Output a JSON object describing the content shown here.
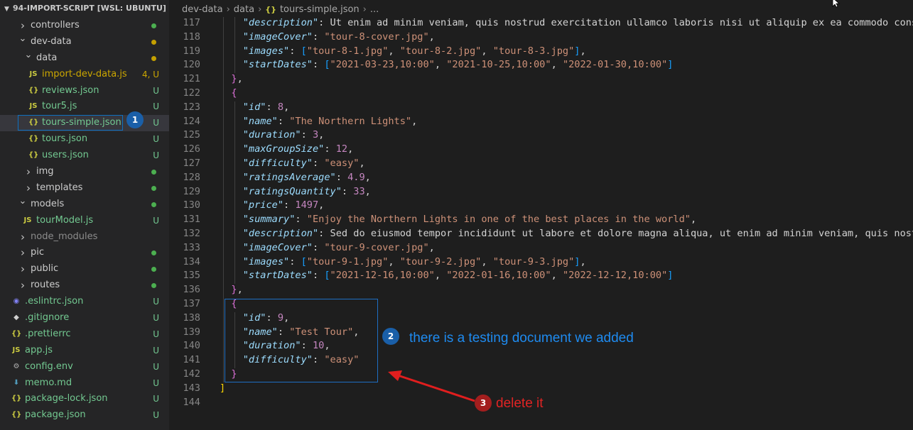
{
  "explorer": {
    "title": "94-IMPORT-SCRIPT [WSL: UBUNTU]",
    "items": [
      {
        "label": "controllers",
        "type": "folder",
        "depth": 1,
        "open": false,
        "status": "",
        "dot": "#4caf50",
        "color": "#cccccc"
      },
      {
        "label": "dev-data",
        "type": "folder",
        "depth": 1,
        "open": true,
        "status": "",
        "dot": "#c4a000",
        "color": "#cccccc"
      },
      {
        "label": "data",
        "type": "folder",
        "depth": 2,
        "open": true,
        "status": "",
        "dot": "#c4a000",
        "color": "#cccccc"
      },
      {
        "label": "import-dev-data.js",
        "type": "js",
        "depth": 3,
        "status": "4, U",
        "color": "#cca700"
      },
      {
        "label": "reviews.json",
        "type": "json",
        "depth": 3,
        "status": "U",
        "color": "#73c991"
      },
      {
        "label": "tour5.js",
        "type": "js",
        "depth": 3,
        "status": "U",
        "color": "#73c991"
      },
      {
        "label": "tours-simple.json",
        "type": "json",
        "depth": 3,
        "status": "U",
        "color": "#73c991",
        "selected": true
      },
      {
        "label": "tours.json",
        "type": "json",
        "depth": 3,
        "status": "U",
        "color": "#73c991"
      },
      {
        "label": "users.json",
        "type": "json",
        "depth": 3,
        "status": "U",
        "color": "#73c991"
      },
      {
        "label": "img",
        "type": "folder",
        "depth": 2,
        "open": false,
        "status": "",
        "dot": "#4caf50",
        "color": "#cccccc"
      },
      {
        "label": "templates",
        "type": "folder",
        "depth": 2,
        "open": false,
        "status": "",
        "dot": "#4caf50",
        "color": "#cccccc"
      },
      {
        "label": "models",
        "type": "folder",
        "depth": 1,
        "open": true,
        "status": "",
        "dot": "#4caf50",
        "color": "#cccccc"
      },
      {
        "label": "tourModel.js",
        "type": "js",
        "depth": 2,
        "status": "U",
        "color": "#73c991"
      },
      {
        "label": "node_modules",
        "type": "folder",
        "depth": 1,
        "open": false,
        "status": "",
        "dot": "",
        "color": "#8c8c8c"
      },
      {
        "label": "pic",
        "type": "folder",
        "depth": 1,
        "open": false,
        "status": "",
        "dot": "#4caf50",
        "color": "#cccccc"
      },
      {
        "label": "public",
        "type": "folder",
        "depth": 1,
        "open": false,
        "status": "",
        "dot": "#4caf50",
        "color": "#cccccc"
      },
      {
        "label": "routes",
        "type": "folder",
        "depth": 1,
        "open": false,
        "status": "",
        "dot": "#4caf50",
        "color": "#cccccc"
      },
      {
        "label": ".eslintrc.json",
        "type": "eslint",
        "depth": 0,
        "status": "U",
        "color": "#73c991"
      },
      {
        "label": ".gitignore",
        "type": "git",
        "depth": 0,
        "status": "U",
        "color": "#73c991"
      },
      {
        "label": ".prettierrc",
        "type": "json",
        "depth": 0,
        "status": "U",
        "color": "#73c991"
      },
      {
        "label": "app.js",
        "type": "js",
        "depth": 0,
        "status": "U",
        "color": "#73c991"
      },
      {
        "label": "config.env",
        "type": "gear",
        "depth": 0,
        "status": "U",
        "color": "#73c991"
      },
      {
        "label": "memo.md",
        "type": "md",
        "depth": 0,
        "status": "U",
        "color": "#73c991"
      },
      {
        "label": "package-lock.json",
        "type": "json",
        "depth": 0,
        "status": "U",
        "color": "#73c991"
      },
      {
        "label": "package.json",
        "type": "json",
        "depth": 0,
        "status": "U",
        "color": "#73c991"
      }
    ]
  },
  "breadcrumb": {
    "parts": [
      "dev-data",
      "data"
    ],
    "file": "tours-simple.json",
    "trailing": "..."
  },
  "code_lines": [
    {
      "n": "117",
      "t": "    \"description\": \"Ut enim ad minim veniam, quis nostrud exercitation ullamco laboris nisi ut aliquip ex ea commodo conse"
    },
    {
      "n": "118",
      "t": "    \"imageCover\": \"tour-8-cover.jpg\","
    },
    {
      "n": "119",
      "t": "    \"images\": [\"tour-8-1.jpg\", \"tour-8-2.jpg\", \"tour-8-3.jpg\"],"
    },
    {
      "n": "120",
      "t": "    \"startDates\": [\"2021-03-23,10:00\", \"2021-10-25,10:00\", \"2022-01-30,10:00\"]"
    },
    {
      "n": "121",
      "t": "  },"
    },
    {
      "n": "122",
      "t": "  {"
    },
    {
      "n": "123",
      "t": "    \"id\": 8,"
    },
    {
      "n": "124",
      "t": "    \"name\": \"The Northern Lights\","
    },
    {
      "n": "125",
      "t": "    \"duration\": 3,"
    },
    {
      "n": "126",
      "t": "    \"maxGroupSize\": 12,"
    },
    {
      "n": "127",
      "t": "    \"difficulty\": \"easy\","
    },
    {
      "n": "128",
      "t": "    \"ratingsAverage\": 4.9,"
    },
    {
      "n": "129",
      "t": "    \"ratingsQuantity\": 33,"
    },
    {
      "n": "130",
      "t": "    \"price\": 1497,"
    },
    {
      "n": "131",
      "t": "    \"summary\": \"Enjoy the Northern Lights in one of the best places in the world\","
    },
    {
      "n": "132",
      "t": "    \"description\": \"Sed do eiusmod tempor incididunt ut labore et dolore magna aliqua, ut enim ad minim veniam, quis nostr"
    },
    {
      "n": "133",
      "t": "    \"imageCover\": \"tour-9-cover.jpg\","
    },
    {
      "n": "134",
      "t": "    \"images\": [\"tour-9-1.jpg\", \"tour-9-2.jpg\", \"tour-9-3.jpg\"],"
    },
    {
      "n": "135",
      "t": "    \"startDates\": [\"2021-12-16,10:00\", \"2022-01-16,10:00\", \"2022-12-12,10:00\"]"
    },
    {
      "n": "136",
      "t": "  },"
    },
    {
      "n": "137",
      "t": "  {"
    },
    {
      "n": "138",
      "t": "    \"id\": 9,"
    },
    {
      "n": "139",
      "t": "    \"name\": \"Test Tour\","
    },
    {
      "n": "140",
      "t": "    \"duration\": 10,"
    },
    {
      "n": "141",
      "t": "    \"difficulty\": \"easy\""
    },
    {
      "n": "142",
      "t": "  }"
    },
    {
      "n": "143",
      "t": "]"
    },
    {
      "n": "144",
      "t": ""
    }
  ],
  "annotations": {
    "badge1": "1",
    "badge2": "2",
    "badge3": "3",
    "note2": "there is a testing document we added",
    "note3": "delete it"
  },
  "colors": {
    "key": "#9cdcfe",
    "string": "#ce9178",
    "number": "#b5cea8",
    "annotation_blue": "#1e8bf0",
    "annotation_red": "#e02424"
  }
}
